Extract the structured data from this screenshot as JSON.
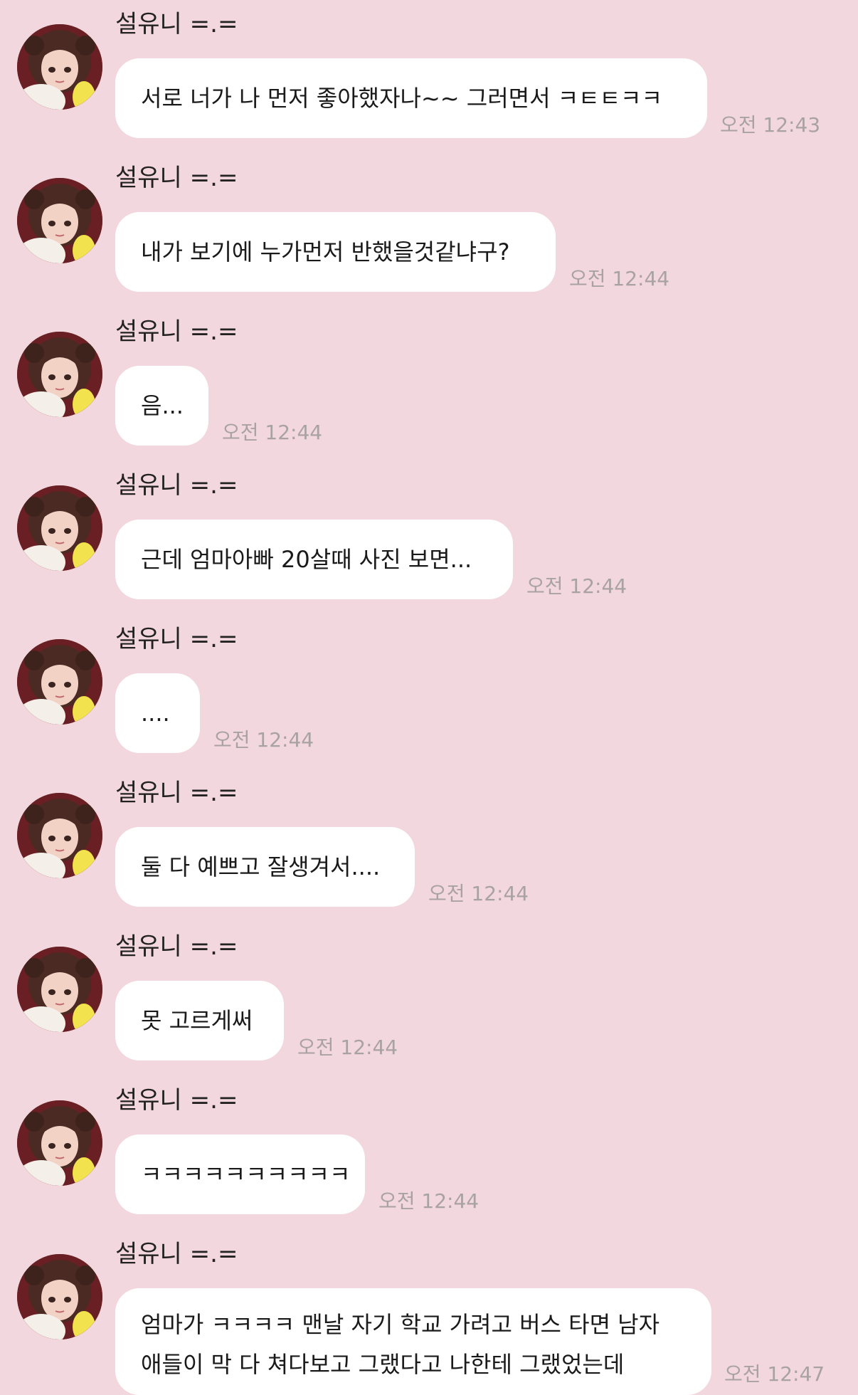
{
  "chat": {
    "sender_name": "설유니 =.=",
    "messages": [
      {
        "text": "서로 너가 나 먼저 좋아했자나~~ 그러면서 ㅋㅌㅌㅋㅋ",
        "time": "오전 12:43"
      },
      {
        "text": "내가 보기에 누가먼저 반했을것같냐구?",
        "time": "오전 12:44"
      },
      {
        "text": "음...",
        "time": "오전 12:44"
      },
      {
        "text": "근데 엄마아빠 20살때 사진 보면...",
        "time": "오전 12:44"
      },
      {
        "text": "....",
        "time": "오전 12:44"
      },
      {
        "text": "둘 다 예쁘고 잘생겨서....",
        "time": "오전 12:44"
      },
      {
        "text": "못 고르게써",
        "time": "오전 12:44"
      },
      {
        "text": "ㅋㅋㅋㅋㅋㅋㅋㅋㅋㅋ",
        "time": "오전 12:44"
      },
      {
        "text": "엄마가 ㅋㅋㅋㅋ 맨날 자기 학교 가려고 버스 타면 남자\n애들이 막 다 쳐다보고 그랬다고 나한테 그랬었는데",
        "time": "오전 12:47"
      }
    ]
  }
}
